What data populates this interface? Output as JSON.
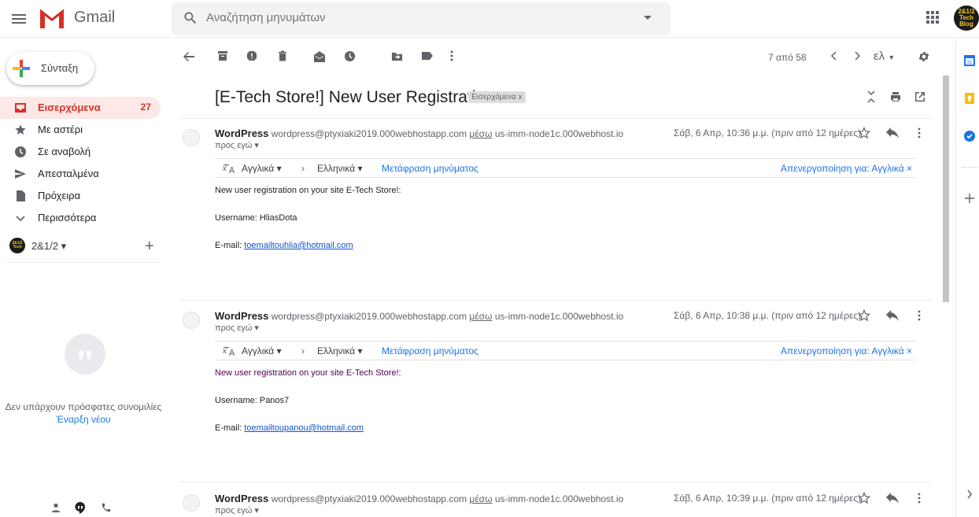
{
  "header": {
    "app_name": "Gmail",
    "search_placeholder": "Αναζήτηση μηνυμάτων",
    "avatar_text": "2&1/2 Tech Blog"
  },
  "sidebar": {
    "compose_label": "Σύνταξη",
    "items": [
      {
        "label": "Εισερχόμενα",
        "count": "27",
        "icon": "inbox-icon"
      },
      {
        "label": "Με αστέρι",
        "icon": "star-icon"
      },
      {
        "label": "Σε αναβολή",
        "icon": "clock-icon"
      },
      {
        "label": "Απεσταλμένα",
        "icon": "send-icon"
      },
      {
        "label": "Πρόχειρα",
        "icon": "draft-icon"
      },
      {
        "label": "Περισσότερα",
        "icon": "chevron-down-icon"
      }
    ],
    "hangouts_user": "2&1/2",
    "no_chats": "Δεν υπάρχουν πρόσφατες συνομιλίες",
    "start_new": "Έναρξη νέου"
  },
  "toolbar": {
    "pager": "7 από 58",
    "lang": "ελ"
  },
  "thread": {
    "subject": "[E-Tech Store!] New User Registration",
    "label": "Εισερχόμενα x",
    "messages": [
      {
        "sender": "WordPress",
        "email": "wordpress@ptyxiaki2019.000webhostapp.com",
        "via": "μέσω",
        "via_host": "us-imm-node1c.000webhost.io",
        "to": "προς εγώ ▾",
        "date": "Σάβ, 6 Απρ, 10:36 μ.μ. (πριν από 12 ημέρες)",
        "trans_src": "Αγγλικά ▾",
        "trans_dst": "Ελληνικά ▾",
        "trans_link": "Μετάφραση μηνύματος",
        "trans_off": "Απενεργοποίηση για: Αγγλικά ×",
        "line1": "New user registration on your site E-Tech Store!:",
        "line2": "Username: HliasDota",
        "email_label": "E-mail: ",
        "email_link": "toemailtouhlia@hotmail.com"
      },
      {
        "sender": "WordPress",
        "email": "wordpress@ptyxiaki2019.000webhostapp.com",
        "via": "μέσω",
        "via_host": "us-imm-node1c.000webhost.io",
        "to": "προς εγώ ▾",
        "date": "Σάβ, 6 Απρ, 10:38 μ.μ. (πριν από 12 ημέρες)",
        "trans_src": "Αγγλικά ▾",
        "trans_dst": "Ελληνικά ▾",
        "trans_link": "Μετάφραση μηνύματος",
        "trans_off": "Απενεργοποίηση για: Αγγλικά ×",
        "line1": "New user registration on your site E-Tech Store!:",
        "line2": "Username: Panos7",
        "email_label": "E-mail: ",
        "email_link": "toemailtoupanou@hotmail.com"
      },
      {
        "sender": "WordPress",
        "email": "wordpress@ptyxiaki2019.000webhostapp.com",
        "via": "μέσω",
        "via_host": "us-imm-node1c.000webhost.io",
        "to": "προς εγώ ▾",
        "date": "Σάβ, 6 Απρ, 10:39 μ.μ. (πριν από 12 ημέρες)"
      }
    ]
  },
  "colors": {
    "accent_red": "#d93025",
    "link_blue": "#1a73e8"
  }
}
